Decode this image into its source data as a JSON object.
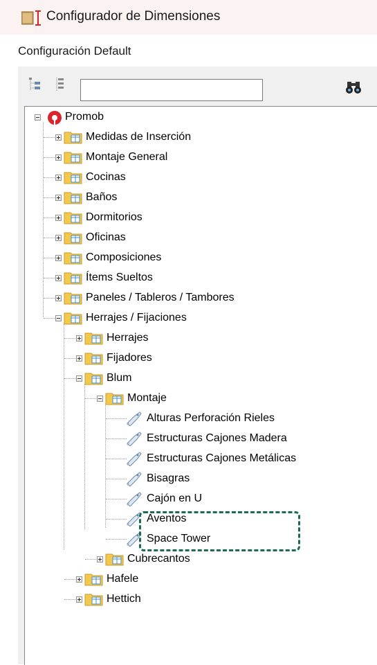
{
  "window": {
    "title": "Configurador de Dimensiones"
  },
  "configuration_label": "Configuración Default",
  "toolbar": {
    "search_value": "",
    "find_icon": "binoculars-icon"
  },
  "tree": {
    "root": "Promob",
    "items": {
      "medidas": "Medidas de Inserción",
      "montaje_general": "Montaje General",
      "cocinas": "Cocinas",
      "banos": "Baños",
      "dormitorios": "Dormitorios",
      "oficinas": "Oficinas",
      "composiciones": "Composiciones",
      "items_sueltos": "Ítems Sueltos",
      "paneles": "Paneles / Tableros / Tambores",
      "herrajes_fijaciones": "Herrajes / Fijaciones",
      "herrajes": "Herrajes",
      "fijadores": "Fijadores",
      "blum": "Blum",
      "montaje": "Montaje",
      "alturas": "Alturas Perforación Rieles",
      "estructuras_madera": "Estructuras Cajones Madera",
      "estructuras_metalicas": "Estructuras Cajones Metálicas",
      "bisagras": "Bisagras",
      "cajon_u": "Cajón en U",
      "aventos": "Aventos",
      "space_tower": "Space Tower",
      "cubrecantos": "Cubrecantos",
      "hafele": "Hafele",
      "hettich": "Hettich"
    }
  },
  "colors": {
    "highlight": "#1b6b56",
    "folder": "#f2c94c",
    "titlebar_bg": "#fbf2f2"
  }
}
